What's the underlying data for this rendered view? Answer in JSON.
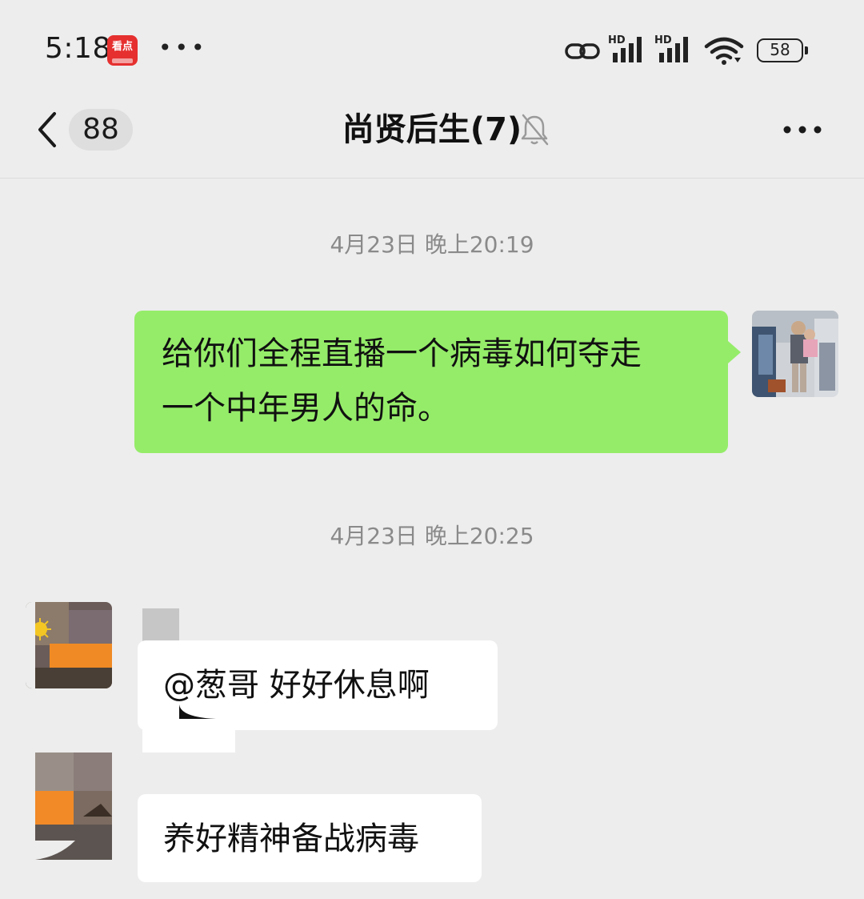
{
  "status_bar": {
    "time": "5:18",
    "app_badge_text": "看点",
    "dots": "•••",
    "network_1": "HD",
    "network_2": "HD",
    "battery": "58"
  },
  "nav": {
    "unread_count": "88",
    "title": "尚贤后生(7)"
  },
  "messages": [
    {
      "type": "timestamp",
      "text": "4月23日 晚上20:19"
    },
    {
      "type": "outgoing",
      "text_line1": "给你们全程直播一个病毒如何夺走",
      "text_line2": "一个中年男人的命。"
    },
    {
      "type": "timestamp",
      "text": "4月23日 晚上20:25"
    },
    {
      "type": "incoming",
      "text": "@葱哥  好好休息啊"
    },
    {
      "type": "incoming",
      "text": "养好精神备战病毒"
    }
  ],
  "colors": {
    "background": "#ededed",
    "outgoing_bubble": "#95ec69",
    "incoming_bubble": "#ffffff",
    "timestamp": "#8a8a8a"
  },
  "icons": {
    "back": "chevron-left-icon",
    "mute": "bell-off-icon",
    "more": "more-horizontal-icon",
    "link": "link-icon",
    "signal": "signal-icon",
    "wifi": "wifi-icon",
    "battery": "battery-icon"
  }
}
